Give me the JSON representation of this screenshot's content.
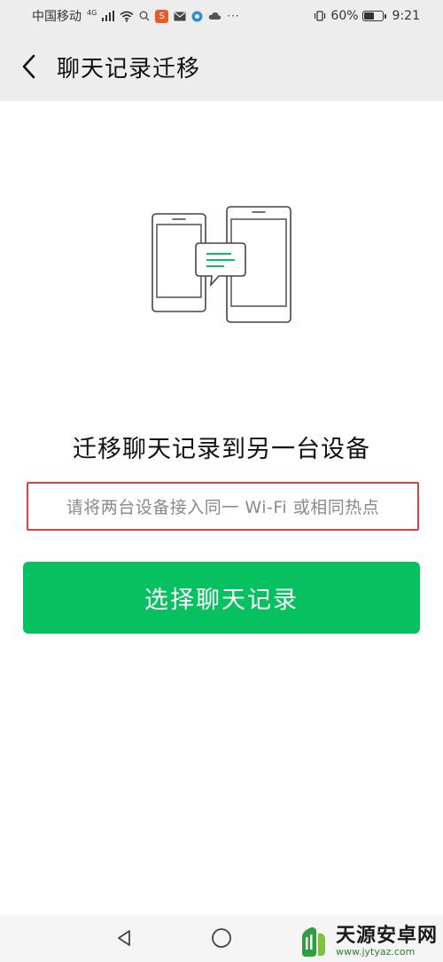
{
  "status_bar": {
    "carrier": "中国移动",
    "network": "4G",
    "battery_percent": "60%",
    "time": "9:21",
    "battery_level": 0.6
  },
  "header": {
    "title": "聊天记录迁移",
    "back_icon": "chevron-left-icon"
  },
  "illustration": {
    "icon": "phone-to-phone-transfer-icon",
    "accent_color": "#07c160"
  },
  "main": {
    "heading": "迁移聊天记录到另一台设备",
    "hint": "请将两台设备接入同一 Wi-Fi 或相同热点",
    "button_label": "选择聊天记录",
    "button_color": "#07c160"
  },
  "nav_bar": {
    "back_icon": "triangle-back-icon",
    "home_icon": "circle-home-icon"
  },
  "watermark": {
    "name": "天源安卓网",
    "url": "www.jytyaz.com"
  }
}
